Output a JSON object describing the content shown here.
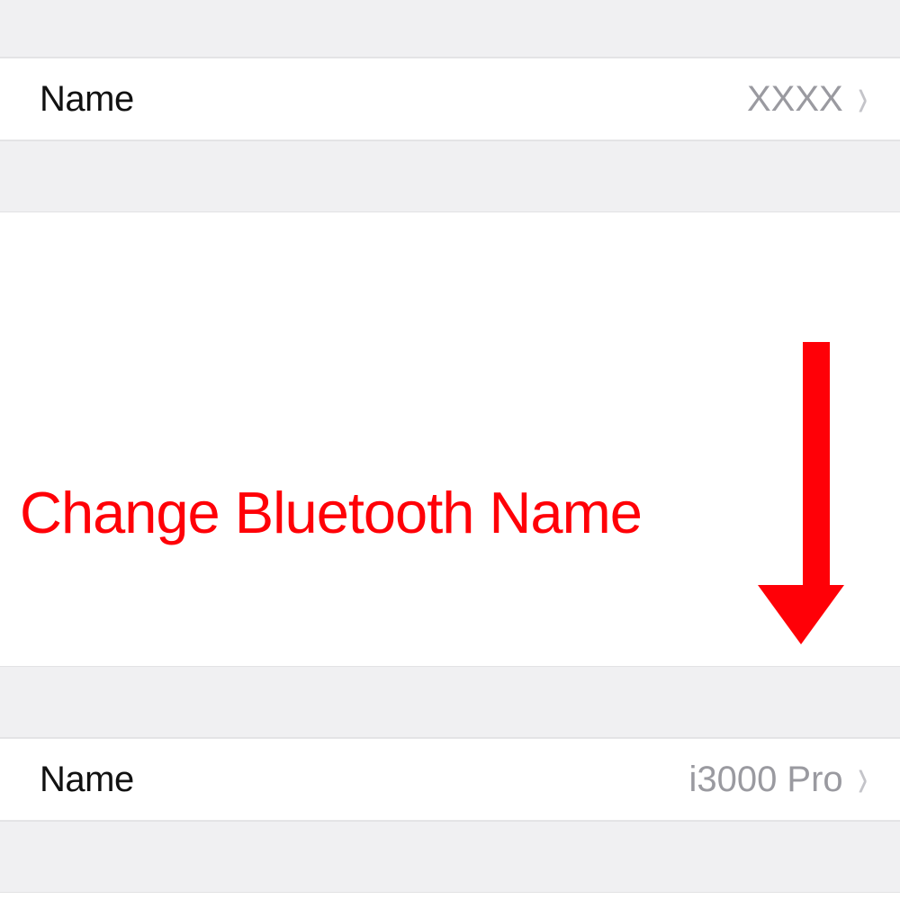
{
  "before": {
    "label": "Name",
    "value": "XXXX"
  },
  "annotation": {
    "text": "Change Bluetooth Name"
  },
  "after": {
    "label": "Name",
    "value": "i3000 Pro"
  }
}
